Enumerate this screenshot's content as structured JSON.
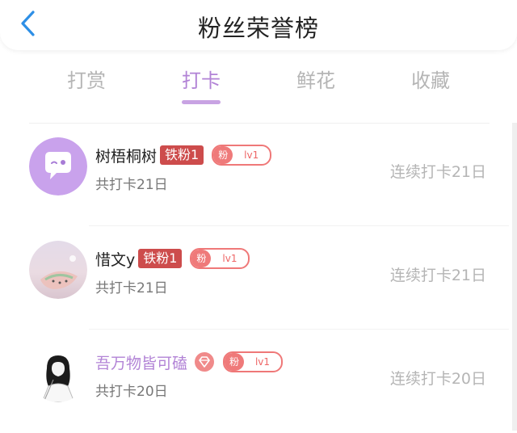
{
  "header": {
    "title": "粉丝荣誉榜"
  },
  "tabs": [
    {
      "label": "打赏",
      "active": false
    },
    {
      "label": "打卡",
      "active": true
    },
    {
      "label": "鲜花",
      "active": false
    },
    {
      "label": "收藏",
      "active": false
    }
  ],
  "colors": {
    "accent": "#b283d6",
    "rank_badge": "#cd4c4c",
    "fan_badge": "#ef7878",
    "muted_text": "#b5b5b5"
  },
  "list": [
    {
      "name": "树梧桐树",
      "rank_badge": "铁粉1",
      "fan_label": "粉",
      "fan_level": "lv1",
      "subtitle": "共打卡21日",
      "streak": "连续打卡21日",
      "avatar": "default-avatar-icon"
    },
    {
      "name": "惜文y",
      "rank_badge": "铁粉1",
      "fan_label": "粉",
      "fan_level": "lv1",
      "subtitle": "共打卡21日",
      "streak": "连续打卡21日",
      "avatar": "photo-avatar"
    },
    {
      "name": "吾万物皆可磕",
      "vip": true,
      "fan_label": "粉",
      "fan_level": "lv1",
      "subtitle": "共打卡20日",
      "streak": "连续打卡20日",
      "avatar": "sketch-girl-avatar"
    }
  ]
}
